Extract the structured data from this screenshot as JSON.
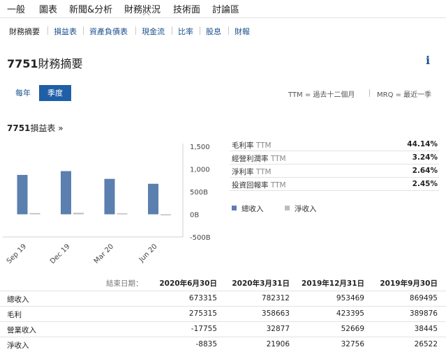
{
  "top_nav": {
    "items": [
      "一般",
      "圖表",
      "新聞&分析",
      "財務狀況",
      "技術面",
      "討論區"
    ],
    "active_index": 3
  },
  "sub_nav": {
    "items": [
      "財務摘要",
      "損益表",
      "資產負債表",
      "現金流",
      "比率",
      "股息",
      "財報"
    ],
    "active_index": 0
  },
  "page": {
    "stock_code": "7751",
    "title": "財務摘要",
    "info_glyph": "i"
  },
  "period_toggle": {
    "annual_label": "每年",
    "quarterly_label": "季度",
    "selected": "季度"
  },
  "notes": {
    "ttm": "TTM = 過去十二個月",
    "mrq": "MRQ = 最近一季"
  },
  "income_link": {
    "code": "7751",
    "label": "損益表 »"
  },
  "chart_data": {
    "type": "bar",
    "categories": [
      "Sep 19",
      "Dec 19",
      "Mar 20",
      "Jun 20"
    ],
    "series": [
      {
        "name": "總收入",
        "values": [
          869495,
          953469,
          782312,
          673315
        ],
        "color": "#5b7fae"
      },
      {
        "name": "淨收入",
        "values": [
          26522,
          32756,
          21906,
          -8835
        ],
        "color": "#bdbdbd"
      }
    ],
    "y_ticks": [
      {
        "value": 1500000,
        "label": "1,500"
      },
      {
        "value": 1000000,
        "label": "1,000"
      },
      {
        "value": 500000,
        "label": "500B"
      },
      {
        "value": 0,
        "label": "0B"
      },
      {
        "value": -500000,
        "label": "-500B"
      }
    ],
    "ylim": [
      -500000,
      1500000
    ],
    "grid": false,
    "legend_position": "right"
  },
  "ratios": [
    {
      "label": "毛利率",
      "suffix": "TTM",
      "value": "44.14%"
    },
    {
      "label": "經營利潤率",
      "suffix": "TTM",
      "value": "3.24%"
    },
    {
      "label": "淨利率",
      "suffix": "TTM",
      "value": "2.64%"
    },
    {
      "label": "投資回報率",
      "suffix": "TTM",
      "value": "2.45%"
    }
  ],
  "legend": {
    "revenue": "總收入",
    "net_income": "淨收入"
  },
  "table": {
    "end_date_label": "結束日期：",
    "columns": [
      "2020年6月30日",
      "2020年3月31日",
      "2019年12月31日",
      "2019年9月30日"
    ],
    "rows": [
      {
        "label": "總收入",
        "values": [
          "673315",
          "782312",
          "953469",
          "869495"
        ]
      },
      {
        "label": "毛利",
        "values": [
          "275315",
          "358663",
          "423395",
          "389876"
        ]
      },
      {
        "label": "營業收入",
        "values": [
          "-17755",
          "32877",
          "52669",
          "38445"
        ]
      },
      {
        "label": "淨收入",
        "values": [
          "-8835",
          "21906",
          "32756",
          "26522"
        ]
      }
    ]
  }
}
